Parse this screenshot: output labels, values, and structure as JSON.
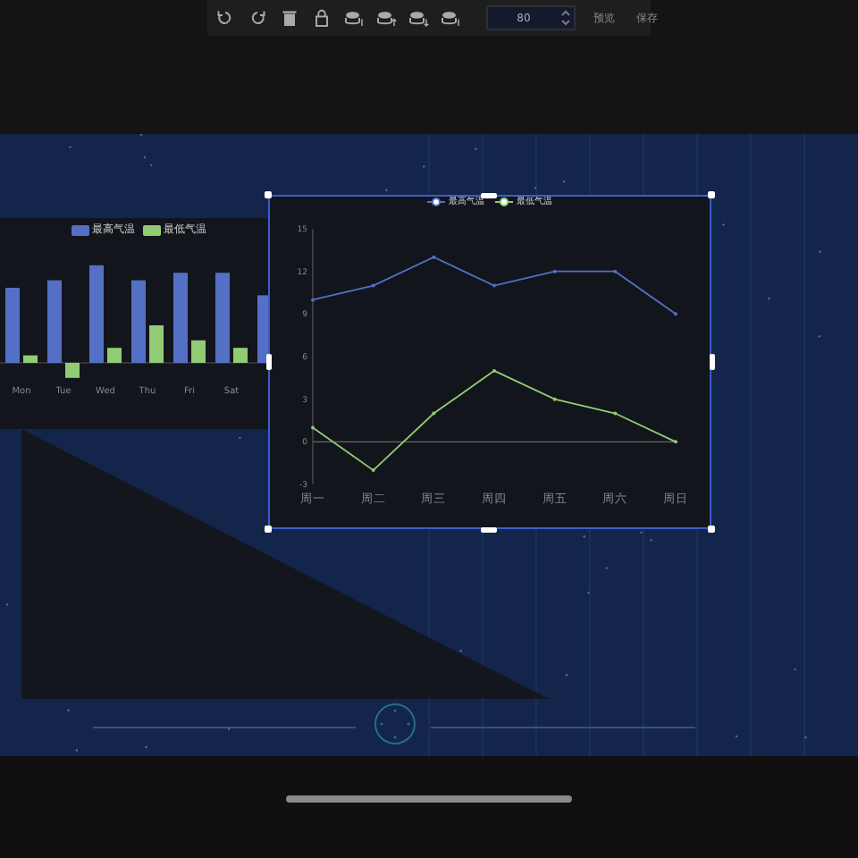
{
  "toolbar": {
    "tools": [
      {
        "kind": "undo"
      },
      {
        "kind": "redo"
      },
      {
        "kind": "delete"
      },
      {
        "kind": "lock"
      },
      {
        "kind": "layer-top"
      },
      {
        "kind": "layer-up"
      },
      {
        "kind": "layer-down"
      },
      {
        "kind": "layer-bottom"
      }
    ],
    "zoom_value": "80",
    "buttons": [
      "预览",
      "保存"
    ]
  },
  "bar_chart": {
    "legend": [
      {
        "label": "最高气温",
        "color": "#5470c6"
      },
      {
        "label": "最低气温",
        "color": "#91cc75"
      }
    ],
    "categories": [
      "Mon",
      "Tue",
      "Wed",
      "Thu",
      "Fri",
      "Sat"
    ]
  },
  "line_chart": {
    "selected": true,
    "chart_data": {
      "type": "line",
      "categories": [
        "周一",
        "周二",
        "周三",
        "周四",
        "周五",
        "周六",
        "周日"
      ],
      "series": [
        {
          "name": "最高气温",
          "color": "#5470c6",
          "values": [
            10,
            11,
            13,
            11,
            12,
            12,
            9
          ]
        },
        {
          "name": "最低气温",
          "color": "#91cc75",
          "values": [
            1,
            -2,
            2,
            5,
            3,
            2,
            0
          ]
        }
      ],
      "ylim": [
        -3,
        15
      ],
      "yticks": [
        -3,
        0,
        3,
        6,
        9,
        12,
        15
      ]
    }
  }
}
